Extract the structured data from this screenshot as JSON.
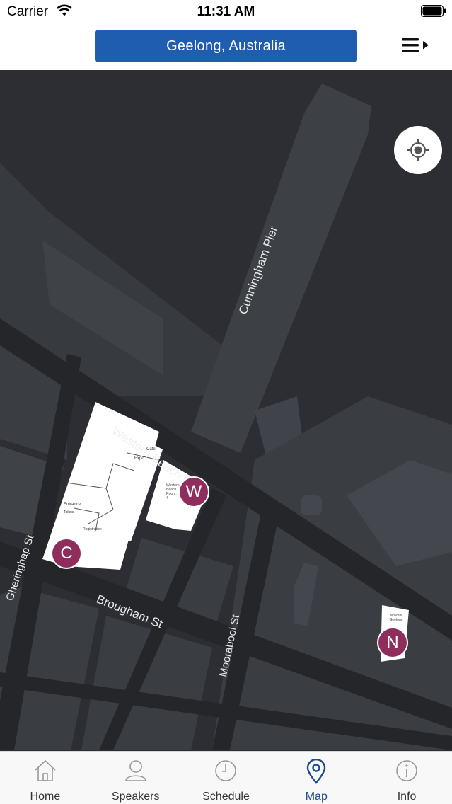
{
  "status_bar": {
    "carrier": "Carrier",
    "time": "11:31 AM"
  },
  "header": {
    "location": "Geelong, Australia",
    "menu_icon": "list-menu-icon"
  },
  "map": {
    "streets": {
      "cunningham_pier": "Cunningham Pier",
      "western_beach_rd": "Western Beach Rd",
      "gheringhap_st": "Gheringhap St",
      "brougham_st": "Brougham St",
      "moorabool_st": "Moorabool St"
    },
    "floorplan": {
      "cafe": "Cafe",
      "expo": "Expo",
      "entrance": "Entrance",
      "toilets": "Toilets",
      "registration": "Registration",
      "western_beach_room": "Western Beach Room, Level 4",
      "novotel": "Novotel Geelong"
    },
    "pins": {
      "c": "C",
      "w": "W",
      "n": "N"
    }
  },
  "tabs": [
    {
      "label": "Home",
      "icon": "home-icon",
      "active": false
    },
    {
      "label": "Speakers",
      "icon": "person-icon",
      "active": false
    },
    {
      "label": "Schedule",
      "icon": "clock-icon",
      "active": false
    },
    {
      "label": "Map",
      "icon": "map-pin-icon",
      "active": true
    },
    {
      "label": "Info",
      "icon": "info-icon",
      "active": false
    }
  ]
}
